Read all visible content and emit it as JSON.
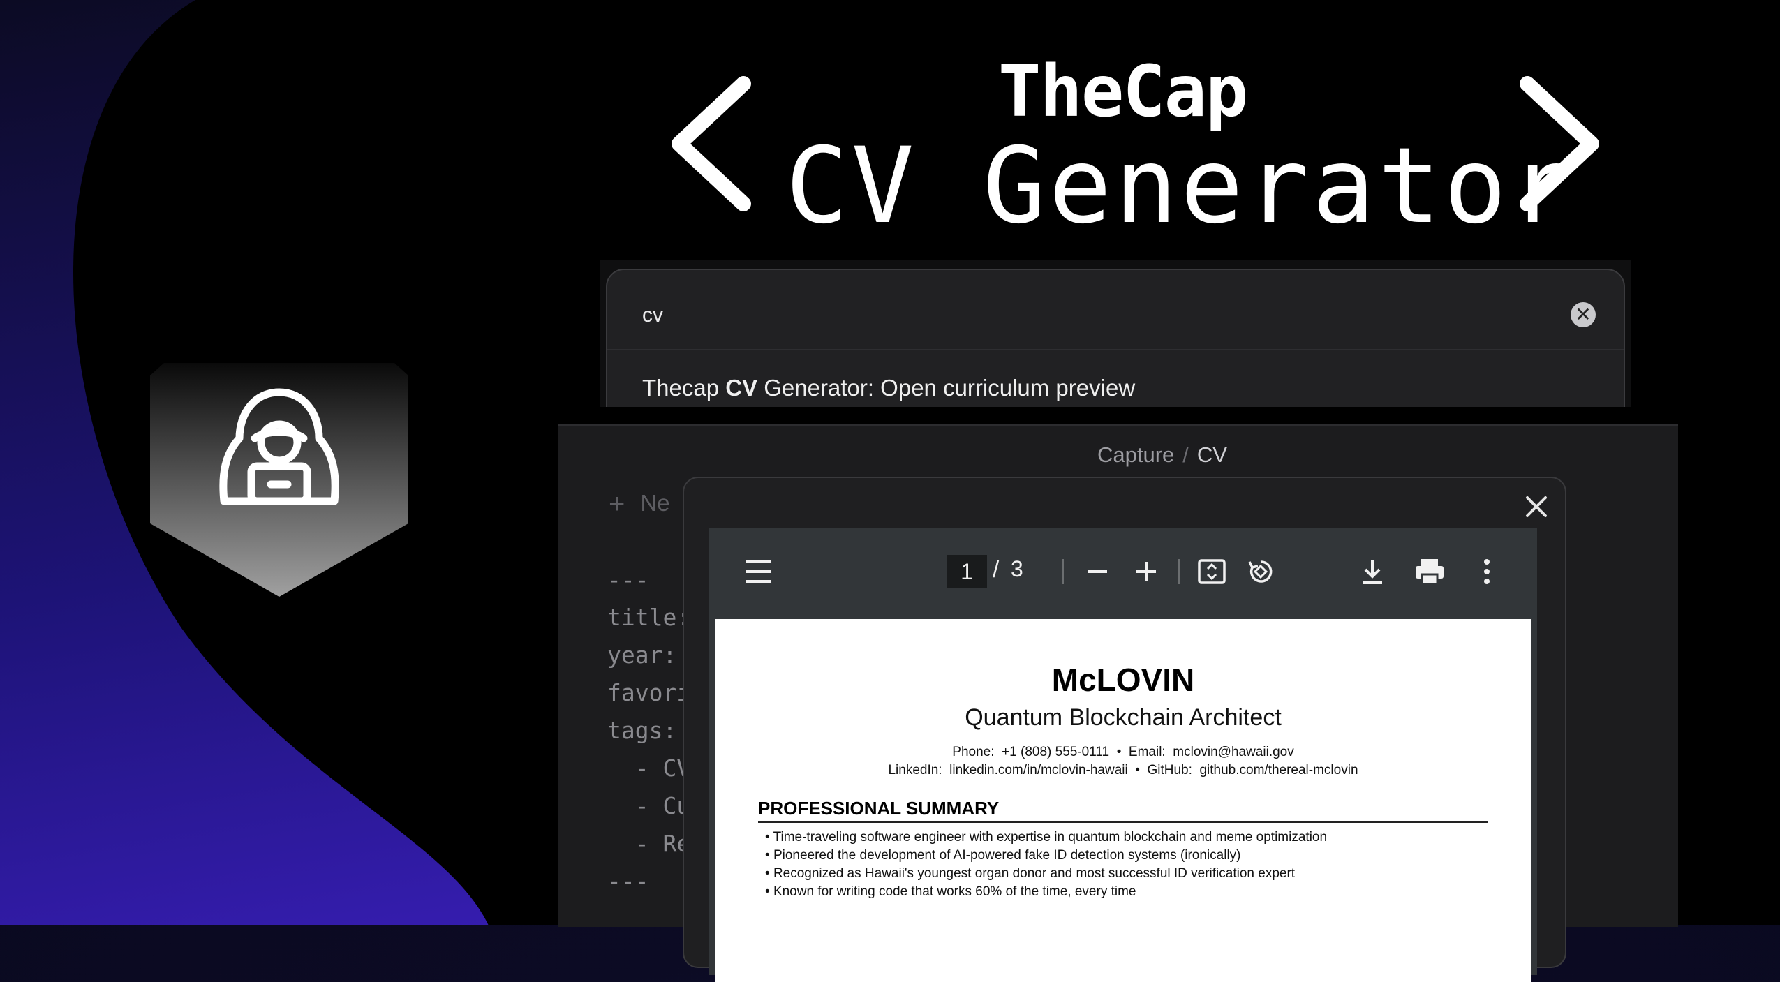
{
  "hero": {
    "title_small": "TheCap",
    "title_big": "CV Generator"
  },
  "search": {
    "query": "cv",
    "clear_glyph": "✕",
    "result_prefix": "Thecap ",
    "result_bold": "CV",
    "result_suffix": " Generator: Open curriculum preview"
  },
  "editor": {
    "breadcrumb_parent": "Capture",
    "breadcrumb_sep": "/",
    "breadcrumb_current": "CV",
    "new_label": "Ne",
    "code_lines": [
      "---",
      "title:",
      "year:",
      "favori",
      "tags:",
      "  - CV",
      "  - Cu",
      "  - Re",
      "---"
    ]
  },
  "viewer": {
    "page_current": "1",
    "page_total": "3",
    "page_slash": "/"
  },
  "cv": {
    "name": "McLOVIN",
    "role": "Quantum Blockchain Architect",
    "phone_label": "Phone:",
    "phone": "+1 (808) 555-0111",
    "email_label": "Email:",
    "email": "mclovin@hawaii.gov",
    "linkedin_label": "LinkedIn:",
    "linkedin": "linkedin.com/in/mclovin-hawaii",
    "github_label": "GitHub:",
    "github": "github.com/thereal-mclovin",
    "dot": "•",
    "section_title": "PROFESSIONAL SUMMARY",
    "bullets": [
      "Time-traveling software engineer with expertise in quantum blockchain and meme optimization",
      "Pioneered the development of AI-powered fake ID detection systems (ironically)",
      "Recognized as Hawaii's youngest organ donor and most successful ID verification expert",
      "Known for writing code that works 60% of the time, every time"
    ]
  },
  "colors": {
    "background": "#0c0b24",
    "accent_purple": "#3a1fbf",
    "panel": "#212123",
    "viewer_toolbar": "#323639"
  }
}
